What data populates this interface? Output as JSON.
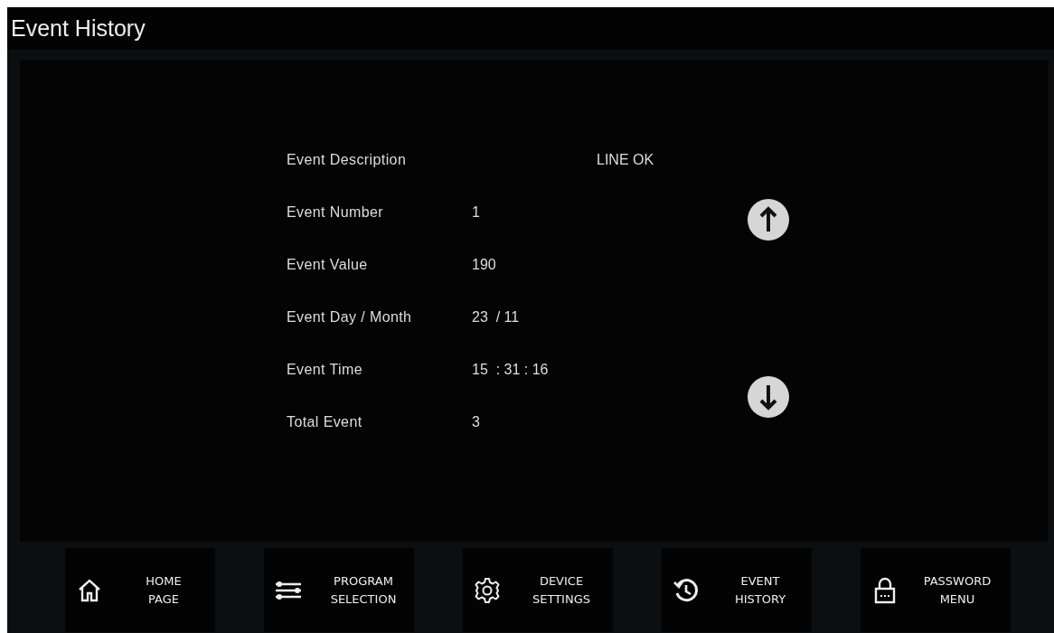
{
  "window": {
    "title": "Event History"
  },
  "fields": [
    {
      "label": "Event Description",
      "value": "LINE OK",
      "kind": "wide"
    },
    {
      "label": "Event Number",
      "value": "1",
      "kind": "plain"
    },
    {
      "label": "Event Value",
      "value": "190",
      "kind": "plain"
    },
    {
      "label": "Event Day / Month",
      "value": "23  / 11",
      "kind": "plain"
    },
    {
      "label": "Event Time",
      "value": "15  : 31 : 16",
      "kind": "plain"
    },
    {
      "label": "Total Event",
      "value": "3",
      "kind": "plain"
    }
  ],
  "nav": [
    {
      "label": "HOME\nPAGE",
      "kind": "home"
    },
    {
      "label": "PROGRAM\nSELECTION",
      "kind": "program"
    },
    {
      "label": "DEVICE\nSETTINGS",
      "kind": "settings"
    },
    {
      "label": "EVENT\nHISTORY",
      "kind": "history"
    },
    {
      "label": "PASSWORD\nMENU",
      "kind": "password"
    }
  ]
}
